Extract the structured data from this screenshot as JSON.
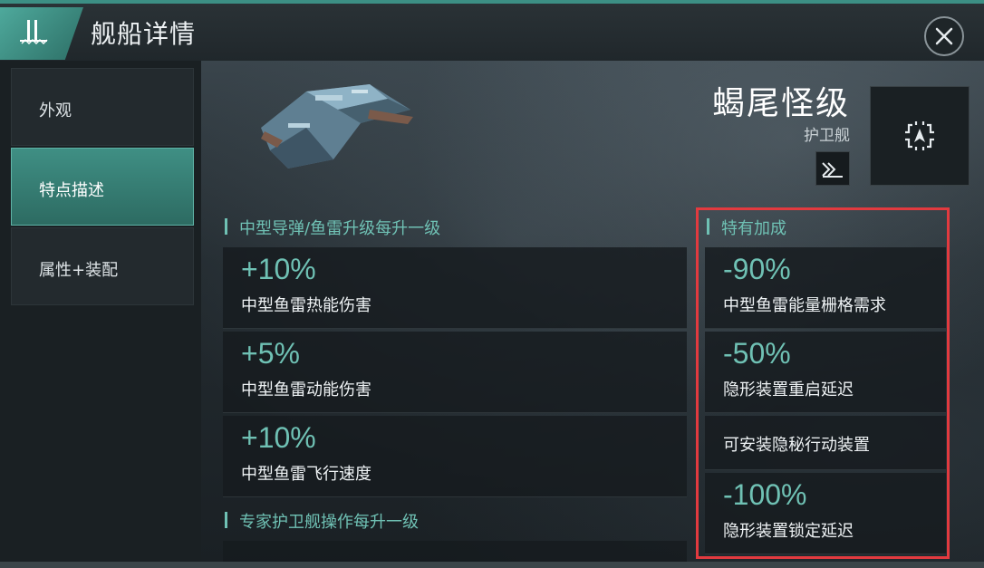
{
  "header": {
    "title": "舰船详情"
  },
  "sidebar": {
    "items": [
      {
        "label": "外观"
      },
      {
        "label": "特点描述",
        "active": true
      },
      {
        "label": "属性+装配"
      }
    ]
  },
  "ship": {
    "name": "蝎尾怪级",
    "class": "护卫舰"
  },
  "skill_sections": [
    {
      "header": "中型导弹/鱼雷升级每升一级",
      "bonuses": [
        {
          "value": "+10%",
          "desc": "中型鱼雷热能伤害"
        },
        {
          "value": "+5%",
          "desc": "中型鱼雷动能伤害"
        },
        {
          "value": "+10%",
          "desc": "中型鱼雷飞行速度"
        }
      ]
    },
    {
      "header": "专家护卫舰操作每升一级",
      "bonuses": []
    }
  ],
  "special": {
    "header": "特有加成",
    "bonuses": [
      {
        "value": "-90%",
        "desc": "中型鱼雷能量栅格需求"
      },
      {
        "value": "-50%",
        "desc": "隐形装置重启延迟"
      },
      {
        "value": "",
        "desc": "可安装隐秘行动装置"
      },
      {
        "value": "-100%",
        "desc": "隐形装置锁定延迟"
      }
    ]
  },
  "colors": {
    "accent": "#6fc1b4",
    "active_tab": "#3f8f84",
    "highlight_border": "#e23a3f"
  },
  "icons": {
    "logo": "fleet-logo-icon",
    "close": "close-icon",
    "ship_type": "frigate-type-icon",
    "navigate": "navigate-target-icon"
  }
}
